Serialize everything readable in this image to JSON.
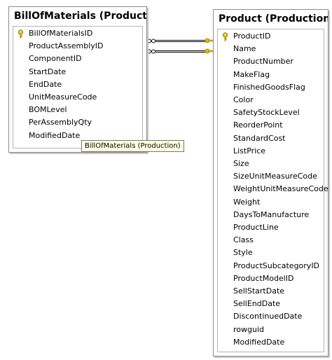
{
  "tables": {
    "bom": {
      "title": "BillOfMaterials (Production)",
      "columns": [
        {
          "name": "BillOfMaterialsID",
          "primary_key": true
        },
        {
          "name": "ProductAssemblyID"
        },
        {
          "name": "ComponentID"
        },
        {
          "name": "StartDate"
        },
        {
          "name": "EndDate"
        },
        {
          "name": "UnitMeasureCode"
        },
        {
          "name": "BOMLevel"
        },
        {
          "name": "PerAssemblyQty"
        },
        {
          "name": "ModifiedDate"
        }
      ]
    },
    "product": {
      "title": "Product (Production)",
      "columns": [
        {
          "name": "ProductID",
          "primary_key": true
        },
        {
          "name": "Name"
        },
        {
          "name": "ProductNumber"
        },
        {
          "name": "MakeFlag"
        },
        {
          "name": "FinishedGoodsFlag"
        },
        {
          "name": "Color"
        },
        {
          "name": "SafetyStockLevel"
        },
        {
          "name": "ReorderPoint"
        },
        {
          "name": "StandardCost"
        },
        {
          "name": "ListPrice"
        },
        {
          "name": "Size"
        },
        {
          "name": "SizeUnitMeasureCode"
        },
        {
          "name": "WeightUnitMeasureCode"
        },
        {
          "name": "Weight"
        },
        {
          "name": "DaysToManufacture"
        },
        {
          "name": "ProductLine"
        },
        {
          "name": "Class"
        },
        {
          "name": "Style"
        },
        {
          "name": "ProductSubcategoryID"
        },
        {
          "name": "ProductModelID"
        },
        {
          "name": "SellStartDate"
        },
        {
          "name": "SellEndDate"
        },
        {
          "name": "DiscontinuedDate"
        },
        {
          "name": "rowguid"
        },
        {
          "name": "ModifiedDate"
        }
      ]
    }
  },
  "tooltip": {
    "text": "BillOfMaterials (Production)"
  },
  "relationships": [
    {
      "from": "BillOfMaterials.ProductAssemblyID",
      "to": "Product.ProductID",
      "from_end": "many",
      "to_end": "one"
    },
    {
      "from": "BillOfMaterials.ComponentID",
      "to": "Product.ProductID",
      "from_end": "many",
      "to_end": "one"
    }
  ],
  "colors": {
    "key_icon": "#e0c000",
    "connector": "#000000",
    "tooltip_bg": "#ffffe1"
  }
}
